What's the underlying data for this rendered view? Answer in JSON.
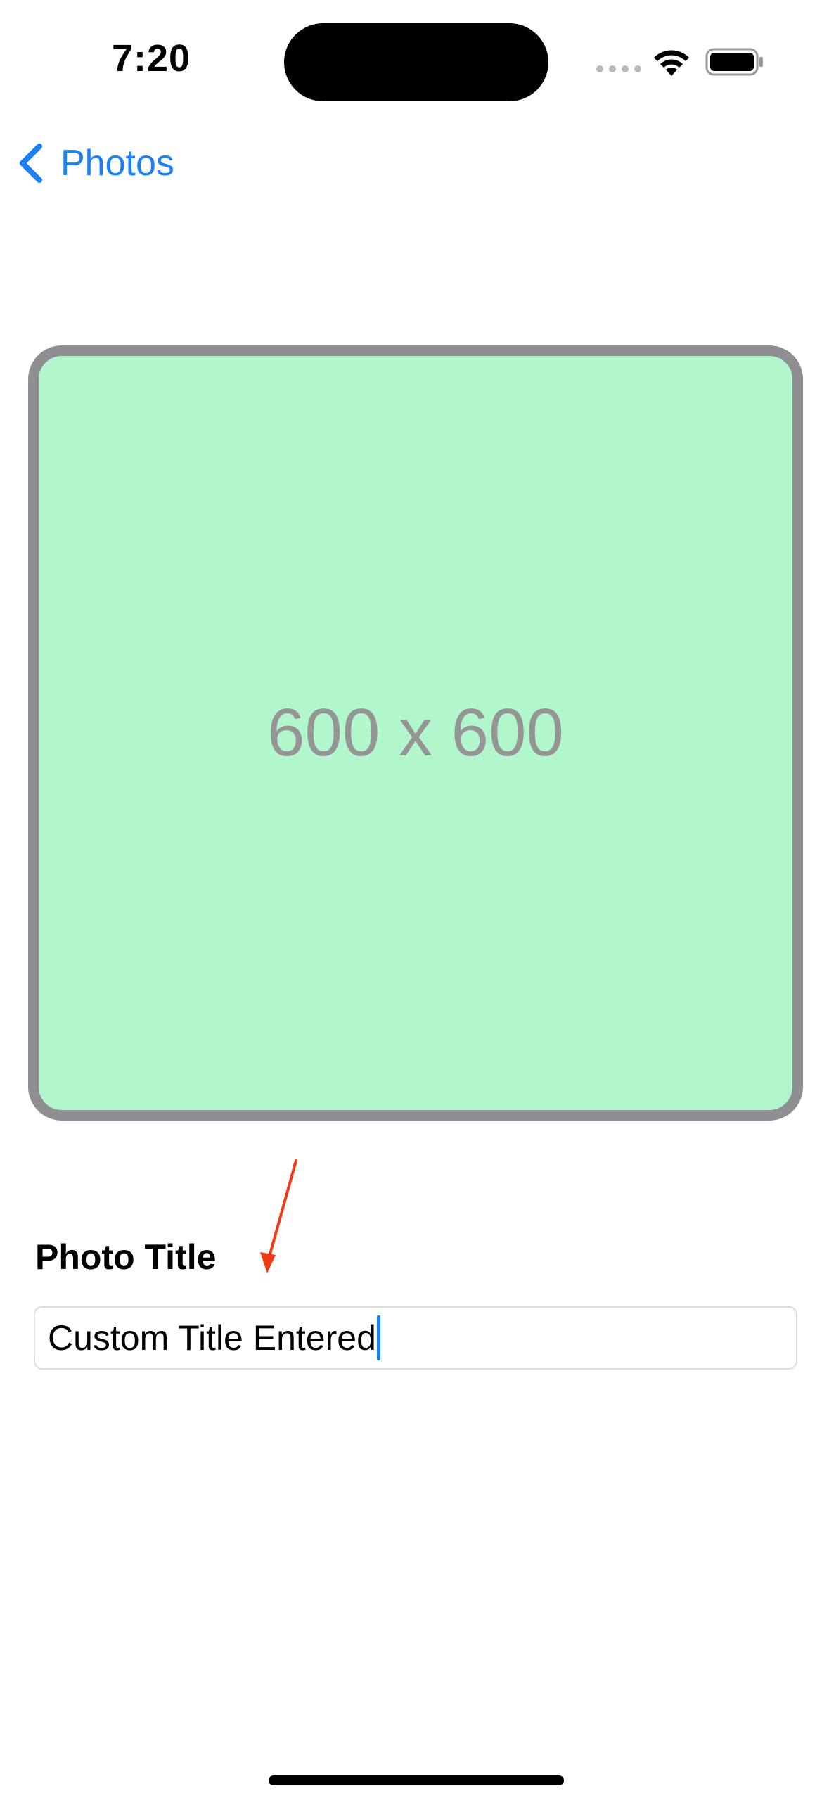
{
  "status_bar": {
    "time": "7:20",
    "wifi_icon": "wifi-icon",
    "battery_icon": "battery-full-icon",
    "signal_icon": "signal-dots-icon"
  },
  "nav": {
    "back_label": "Photos",
    "back_icon": "chevron-left-icon"
  },
  "photo": {
    "placeholder_text": "600 x 600",
    "fill_color": "#b2f7cc",
    "border_color": "#8e8e93"
  },
  "form": {
    "title_label": "Photo Title",
    "title_value": "Custom Title Entered"
  },
  "annotation": {
    "arrow_color": "#f03a17",
    "icon": "annotation-arrow-icon"
  },
  "colors": {
    "accent": "#1e7ff3"
  }
}
